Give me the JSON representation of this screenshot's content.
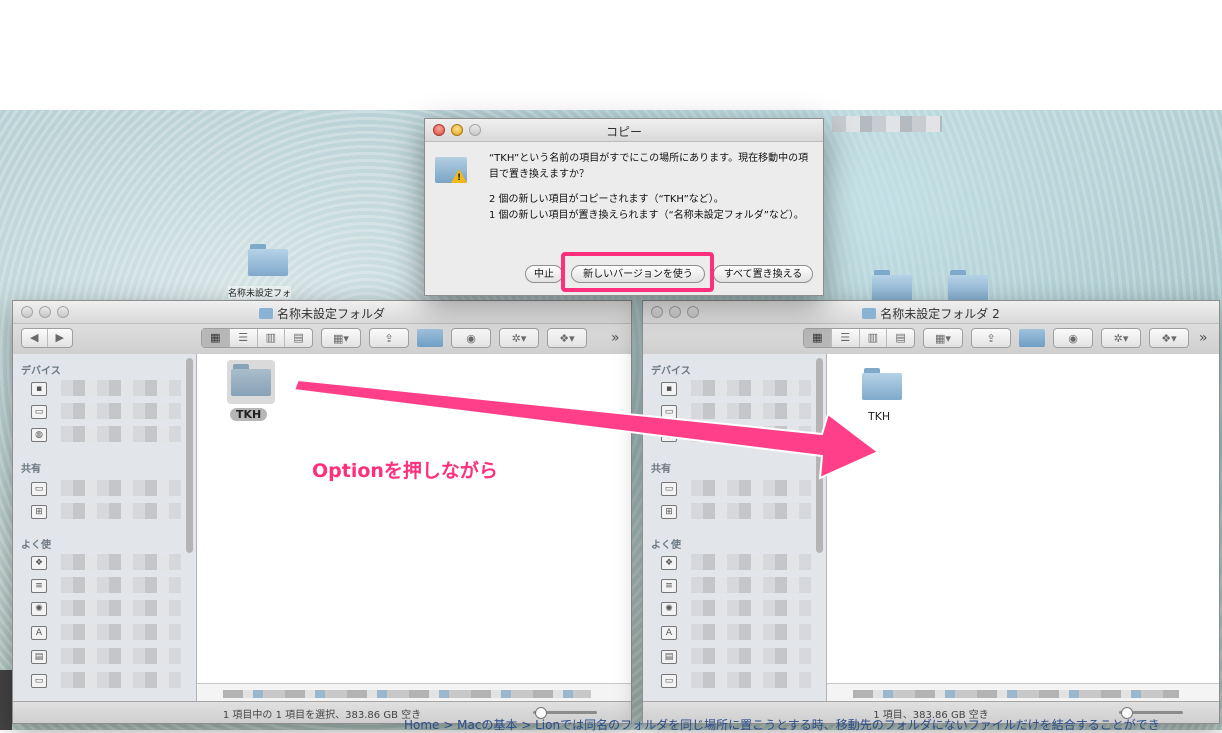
{
  "dialog": {
    "title": "コピー",
    "message_line1": "“TKH”という名前の項目がすでにこの場所にあります。現在移動中の項目で置き換えますか？",
    "message_line2": "2 個の新しい項目がコピーされます（“TKH”など）。",
    "message_line3": "1 個の新しい項目が置き換えられます（“名称未設定フォルダ”など）。",
    "buttons": {
      "cancel": "中止",
      "keep_both": "新しいバージョンを使う",
      "replace_all": "すべて置き換える"
    }
  },
  "left_window": {
    "title": "名称未設定フォルダ",
    "sidebar": {
      "devices": "デバイス",
      "shared": "共有",
      "favorites": "よく使"
    },
    "items": [
      {
        "name": "TKH"
      }
    ],
    "status": "1 項目中の 1 項目を選択、383.86 GB 空き"
  },
  "right_window": {
    "title": "名称未設定フォルダ 2",
    "sidebar": {
      "devices": "デバイス",
      "shared": "共有",
      "favorites": "よく使"
    },
    "items": [
      {
        "name": "TKH"
      }
    ],
    "status": "1 項目、383.86 GB 空き"
  },
  "desktop": {
    "folder_label": "名称未設定フォ"
  },
  "annotation": {
    "text": "Optionを押しながら",
    "color": "#ff2f7d"
  },
  "breadcrumb": "Home > Macの基本 > Lionでは同名のフォルダを同じ場所に置こうとする時、移動先のフォルダにないファイルだけを結合することができ"
}
